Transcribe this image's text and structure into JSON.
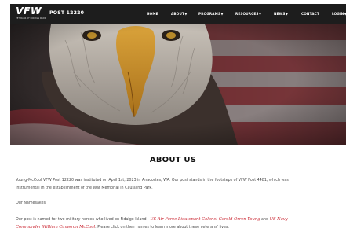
{
  "header": {
    "logo_text": "VFW",
    "logo_tagline": "VETERANS OF FOREIGN WARS",
    "post_title": "POST 12220",
    "menu": [
      {
        "label": "HOME",
        "has_dropdown": false
      },
      {
        "label": "ABOUT",
        "has_dropdown": true
      },
      {
        "label": "PROGRAMS",
        "has_dropdown": true
      },
      {
        "label": "RESOURCES",
        "has_dropdown": true
      },
      {
        "label": "NEWS",
        "has_dropdown": true
      },
      {
        "label": "CONTACT",
        "has_dropdown": false
      },
      {
        "label": "LOGIN",
        "has_dropdown": true
      }
    ],
    "dropdown_icon": "caret-down-icon"
  },
  "hero": {
    "image_subject": "bald-eagle-and-american-flag"
  },
  "main": {
    "heading": "ABOUT US",
    "paragraph1_line1": "Young-McCool VFW Post 12220 was instituted on April 1st, 2023 in Anacortes, WA. Our post stands in the footsteps of VFW Post 4481, which was",
    "paragraph1_line2": "instrumental in the establishment of the War Memorial in Causland Park.",
    "paragraph2": "Our Namesakes",
    "paragraph3_line1_before": "Our post is named for two military heroes who lived on Fidalgo Island - ",
    "link1": "US Air Force Lieutenant Colonel Gerald Orren Young",
    "paragraph3_and": " and ",
    "link2_part1": "US Navy",
    "link2_part2": "Commander William Cameron McCool",
    "paragraph3_line2_after": ". Please click on their names to learn more about these veterans' lives."
  },
  "colors": {
    "nav_background": "#1d1d1d",
    "link_red": "#c81e2a",
    "body_text": "#4a4a4a"
  }
}
